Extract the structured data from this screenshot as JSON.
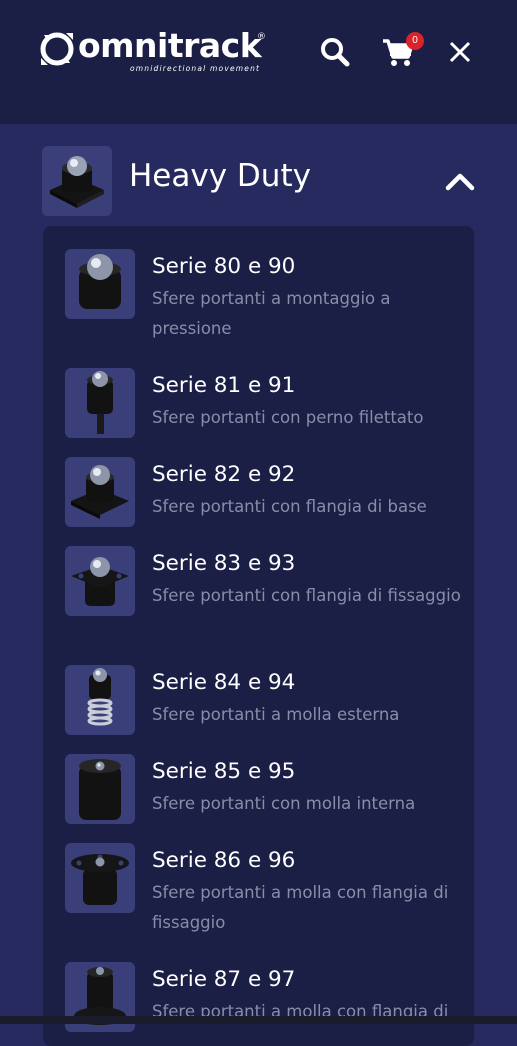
{
  "header": {
    "logo_text": "omnitrack",
    "logo_reg": "®",
    "logo_tagline": "omnidirectional movement",
    "search_icon": "search-icon",
    "cart_icon": "cart-icon",
    "cart_count": "0",
    "close_icon": "close-icon",
    "colors": {
      "background": "#1b1e45",
      "badge": "#d8232a"
    }
  },
  "category": {
    "title": "Heavy Duty",
    "toggle_icon": "chevron-up-icon",
    "colors": {
      "page": "#262a5e",
      "panel": "#1b1e45"
    }
  },
  "items": [
    {
      "title": "Serie 80 e 90",
      "desc": "Sfere portanti a montaggio a pressione",
      "icon": "ball-transfer-press-fit-icon"
    },
    {
      "title": "Serie 81 e 91",
      "desc": "Sfere portanti con perno filettato",
      "icon": "ball-transfer-threaded-stud-icon"
    },
    {
      "title": "Serie 82 e 92",
      "desc": "Sfere portanti con flangia di base",
      "icon": "ball-transfer-base-flange-icon"
    },
    {
      "title": "Serie 83 e 93",
      "desc": "Sfere portanti con flangia di fissaggio",
      "icon": "ball-transfer-mounting-flange-icon"
    },
    {
      "title": "Serie 84 e 94",
      "desc": "Sfere portanti a molla esterna",
      "icon": "ball-transfer-external-spring-icon"
    },
    {
      "title": "Serie 85 e 95",
      "desc": "Sfere portanti con molla interna",
      "icon": "ball-transfer-internal-spring-icon"
    },
    {
      "title": "Serie 86 e 96",
      "desc": "Sfere portanti a molla con flangia di fissaggio",
      "icon": "ball-transfer-spring-flange-icon"
    },
    {
      "title": "Serie 87 e 97",
      "desc": "Sfere portanti a molla con flangia di",
      "icon": "ball-transfer-spring-flange-alt-icon"
    }
  ]
}
